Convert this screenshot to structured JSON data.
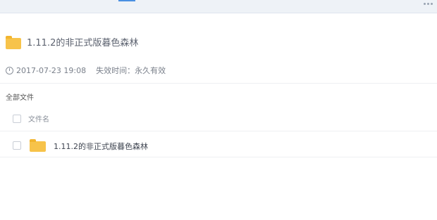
{
  "share": {
    "title": "1.11.2的非正式版暮色森林",
    "date": "2017-07-23 19:08",
    "expiry": "失效时间：永久有效"
  },
  "breadcrumb": {
    "label": "全部文件"
  },
  "table": {
    "column_filename": "文件名",
    "rows": [
      {
        "name": "1.11.2的非正式版暮色森林",
        "icon": "folder-icon"
      }
    ]
  },
  "colors": {
    "folder": "#f7c34a",
    "accent": "#4a90e2"
  }
}
